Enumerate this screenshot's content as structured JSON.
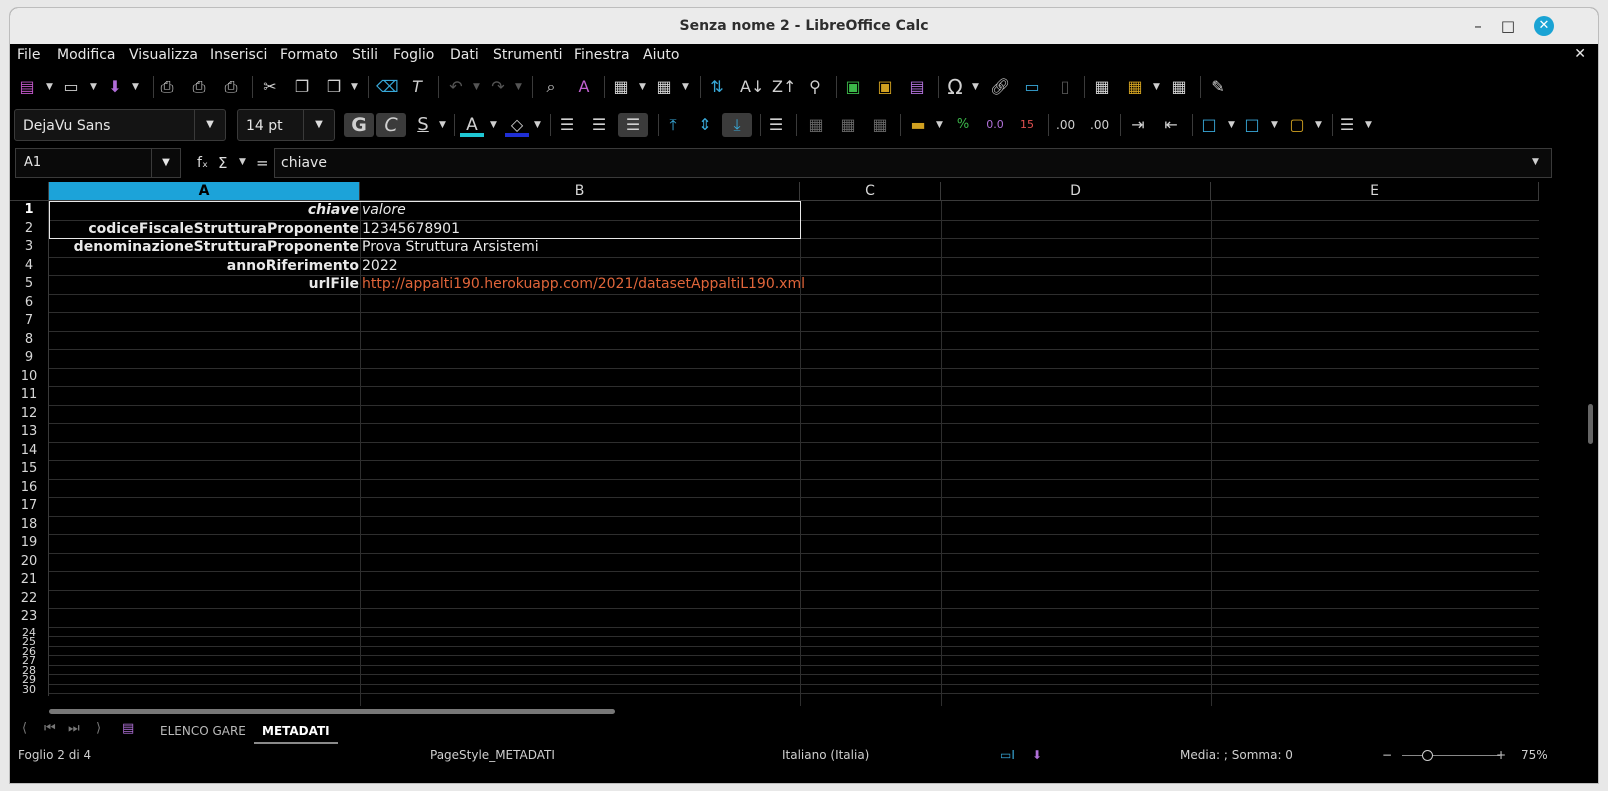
{
  "window": {
    "title": "Senza nome 2 - LibreOffice Calc",
    "minimize": "–",
    "maximize": "□",
    "close": "✕"
  },
  "menu": [
    "File",
    "Modifica",
    "Visualizza",
    "Inserisci",
    "Formato",
    "Stili",
    "Foglio",
    "Dati",
    "Strumenti",
    "Finestra",
    "Aiuto"
  ],
  "menu_close": "✕",
  "formatting": {
    "font_name": "DejaVu Sans",
    "font_size": "14 pt",
    "bold": "G",
    "italic": "C",
    "underline": "S",
    "font_color_letter": "A",
    "font_color": "#1fc7d4",
    "highlight_color": "#1f2fd4"
  },
  "formula_bar": {
    "name_box": "A1",
    "fx": "fₓ",
    "sigma": "Σ",
    "equals": "=",
    "content": "chiave"
  },
  "columns": [
    "A",
    "B",
    "C",
    "D",
    "E"
  ],
  "rows": [
    "1",
    "2",
    "3",
    "4",
    "5",
    "6",
    "7",
    "8",
    "9",
    "10",
    "11",
    "12",
    "13",
    "14",
    "15",
    "16",
    "17",
    "18",
    "19",
    "20",
    "21",
    "22",
    "23",
    "24",
    "25",
    "26",
    "27",
    "28",
    "29",
    "30"
  ],
  "cells": [
    {
      "a": "chiave",
      "b": "valore"
    },
    {
      "a": "codiceFiscaleStrutturaProponente",
      "b": "12345678901"
    },
    {
      "a": "denominazioneStrutturaProponente",
      "b": "Prova Struttura Arsistemi"
    },
    {
      "a": "annoRiferimento",
      "b": "2022"
    },
    {
      "a": "urlFile",
      "b": "http://appalti190.herokuapp.com/2021/datasetAppaltiL190.xml"
    }
  ],
  "sheets": {
    "tabs": [
      "ELENCO GARE",
      "METADATI"
    ],
    "active": "METADATI"
  },
  "status": {
    "sheet": "Foglio 2 di 4",
    "page_style": "PageStyle_METADATI",
    "language": "Italiano (Italia)",
    "summary": "Media: ; Somma: 0",
    "zoom": "75%"
  }
}
